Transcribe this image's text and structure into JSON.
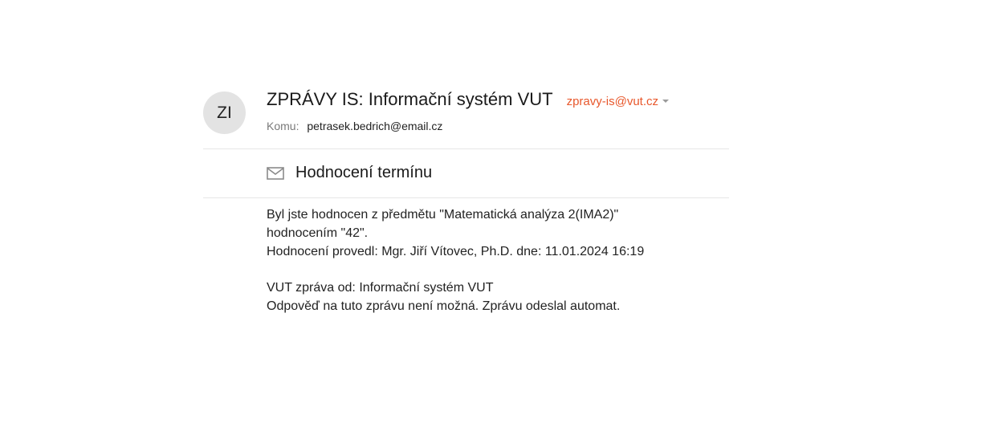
{
  "sender": {
    "avatar_initials": "ZI",
    "name": "ZPRÁVY IS: Informační systém VUT",
    "email": "zpravy-is@vut.cz"
  },
  "recipient": {
    "label": "Komu:",
    "email": "petrasek.bedrich@email.cz"
  },
  "subject": {
    "icon": "envelope-icon",
    "text": "Hodnocení termínu"
  },
  "body": {
    "paragraph1": [
      "Byl jste hodnocen z předmětu \"Matematická analýza 2(IMA2)\"",
      "hodnocením \"42\".",
      "Hodnocení provedl: Mgr. Jiří Vítovec, Ph.D. dne: 11.01.2024 16:19"
    ],
    "paragraph2": [
      "VUT zpráva od: Informační systém VUT",
      "Odpověď na tuto zprávu není možná. Zprávu odeslal automat."
    ]
  },
  "colors": {
    "accent": "#e8572b",
    "avatar_bg": "#e3e3e3",
    "divider": "#e6e6e6"
  }
}
